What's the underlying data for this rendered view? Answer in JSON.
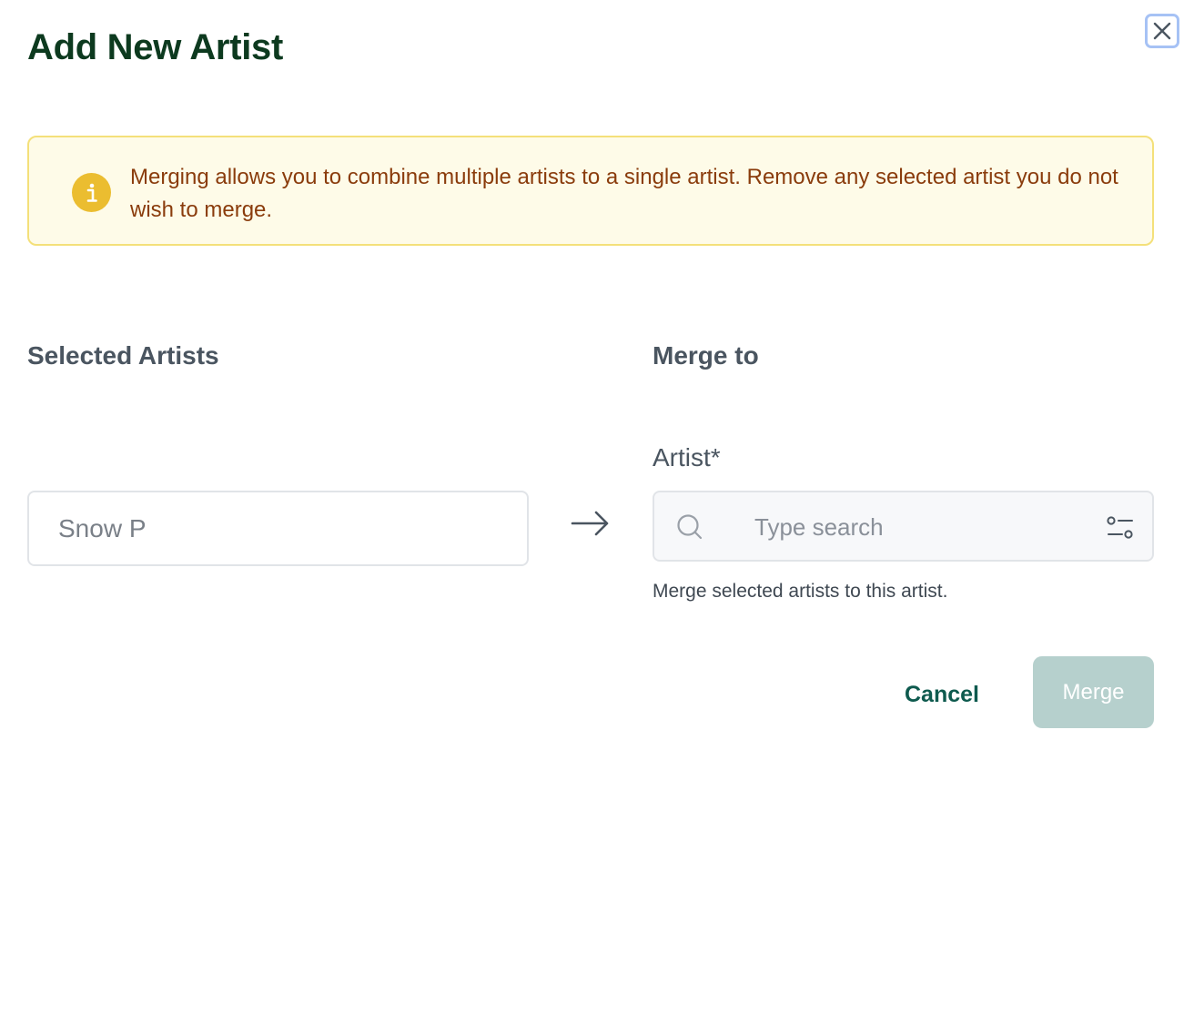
{
  "modal": {
    "title": "Add New Artist",
    "close_icon": "close-icon"
  },
  "alert": {
    "icon": "info-icon",
    "text": "Merging allows you to combine multiple artists to a single artist. Remove any selected artist you do not wish to merge.",
    "colors": {
      "background": "#fefbe8",
      "border": "#f4e07a",
      "text": "#8a3c0c",
      "icon": "#ebbd30"
    }
  },
  "selected": {
    "label": "Selected Artists",
    "items": [
      "Snow P"
    ]
  },
  "merge_to": {
    "label": "Merge to",
    "field_label": "Artist*",
    "search": {
      "placeholder": "Type search",
      "value": ""
    },
    "helper": "Merge selected artists to this artist."
  },
  "actions": {
    "cancel_label": "Cancel",
    "merge_label": "Merge",
    "merge_disabled": true
  },
  "colors": {
    "title": "#0d3a1f",
    "accent": "#0e5a4e",
    "merge_button_disabled": "#b6d0cd"
  }
}
